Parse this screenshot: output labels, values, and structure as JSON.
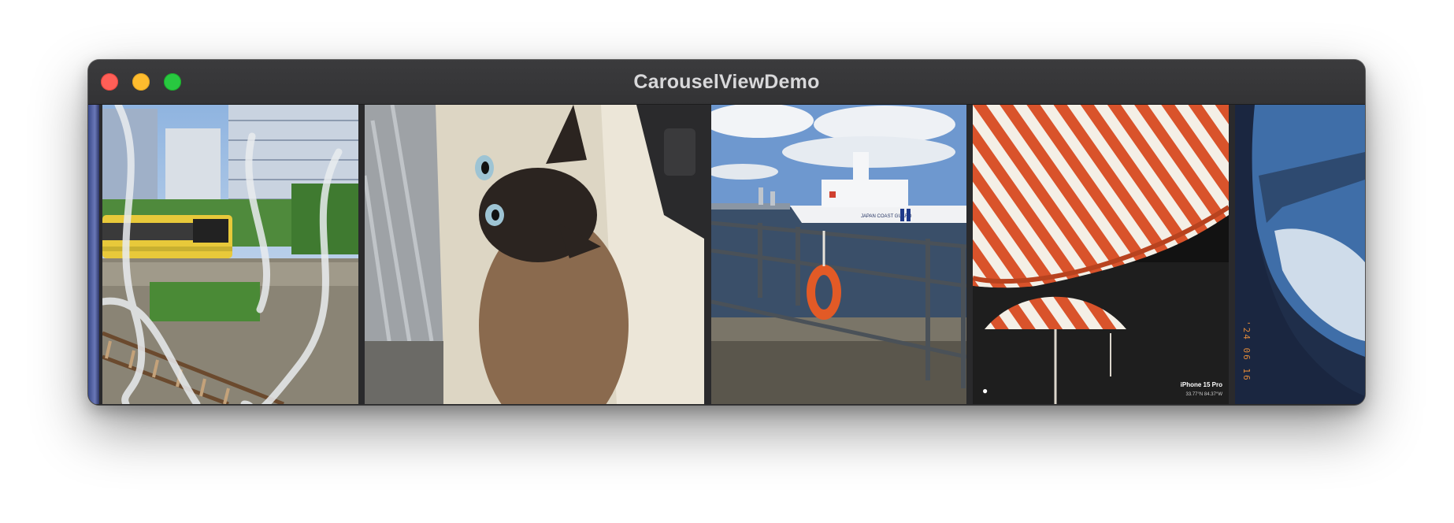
{
  "window": {
    "title": "CarouselViewDemo",
    "traffic_lights": [
      {
        "name": "close",
        "color": "#ff5f57"
      },
      {
        "name": "minimize",
        "color": "#febc2e"
      },
      {
        "name": "zoom",
        "color": "#28c840"
      }
    ]
  },
  "carousel": {
    "photos": [
      {
        "subject": "partial blue photo"
      },
      {
        "subject": "yellow commuter train behind chain-link fence"
      },
      {
        "subject": "siamese cat looking up"
      },
      {
        "subject": "coast guard ship and pier railing with life ring",
        "ship_text": "JAPAN COAST GUARD"
      },
      {
        "subject": "orange and white striped umbrellas",
        "watermark_model": "iPhone 15 Pro",
        "watermark_coords": "33.77°N 84.37°W"
      },
      {
        "subject": "airplane wing through window",
        "date_stamp": "'24 06 16"
      }
    ]
  }
}
